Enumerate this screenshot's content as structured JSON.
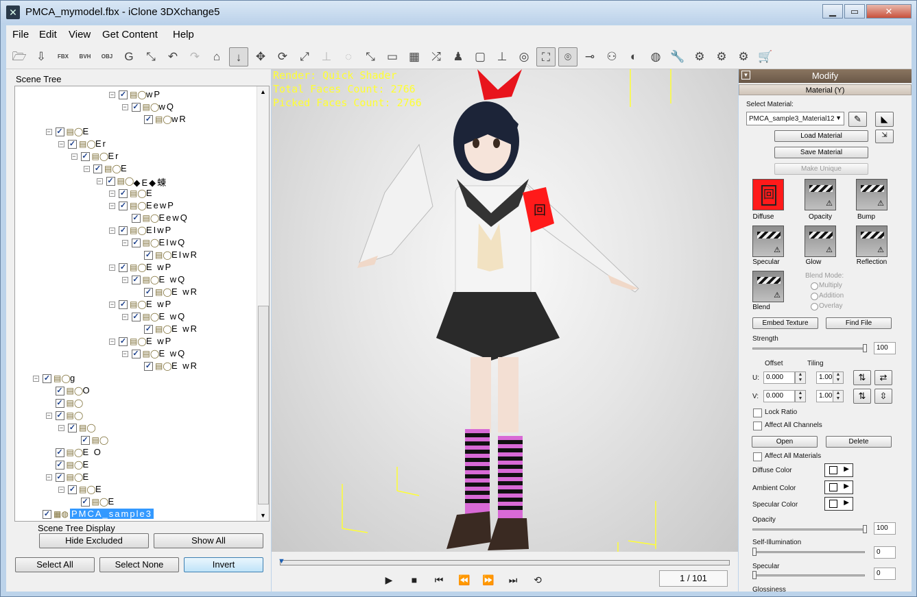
{
  "window": {
    "title": "PMCA_mymodel.fbx - iClone 3DXchange5",
    "minimize": "▁",
    "maximize": "▭",
    "close": "✕"
  },
  "menu": [
    "File",
    "Edit",
    "View",
    "Get Content",
    "Help"
  ],
  "toolbar": {
    "icons": [
      "open-folder-icon",
      "import-icon",
      "export-fbx-icon",
      "export-bvh-icon",
      "export-obj-icon",
      "g-icon",
      "convert-icon",
      "undo-icon",
      "redo-icon",
      "home-icon",
      "select-icon",
      "move-icon",
      "rotate-icon",
      "scale-icon",
      "align-icon",
      "reset-icon",
      "frame-icon",
      "box-icon",
      "grid-icon",
      "axis-icon",
      "character-icon",
      "camera-view-icon",
      "floor-icon",
      "sphere-icon",
      "fit-icon",
      "render-icon",
      "capsule-icon",
      "bone-icon",
      "bone-color-icon",
      "globe-icon",
      "wrench-icon",
      "settings-icon",
      "network-icon",
      "cube-convert-icon",
      "cart-icon"
    ],
    "glyphs": [
      "🗁",
      "⇩",
      "FBX",
      "BVH",
      "OBJ",
      "G",
      "⤡",
      "↶",
      "↷",
      "⌂",
      "↓",
      "✥",
      "⟳",
      "⤢",
      "⊥",
      "◌",
      "⤡",
      "▭",
      "▦",
      "⤮",
      "♟",
      "▢",
      "⊥",
      "◎",
      "⛶",
      "⌾",
      "⊸",
      "⚇",
      "◐",
      "◍",
      "🔧",
      "⚙",
      "⚙",
      "⚙",
      "🛒"
    ],
    "active": [
      10,
      24,
      25
    ],
    "dim": [
      8,
      14,
      15
    ]
  },
  "scene_tree": {
    "label": "Scene Tree",
    "nodes": [
      {
        "label": "wP"
      },
      {
        "label": "wQ"
      },
      {
        "label": "wR"
      },
      {
        "label": "E"
      },
      {
        "label": "Er"
      },
      {
        "label": "Er"
      },
      {
        "label": "E"
      },
      {
        "label": "◆E◆蝀"
      },
      {
        "label": "E"
      },
      {
        "label": "EewP"
      },
      {
        "label": "EewQ"
      },
      {
        "label": "EIwP"
      },
      {
        "label": "EIwQ"
      },
      {
        "label": "EIwR"
      },
      {
        "label": "E wP"
      },
      {
        "label": "E wQ"
      },
      {
        "label": "E wR"
      },
      {
        "label": "E wP"
      },
      {
        "label": "E wQ"
      },
      {
        "label": "E wR"
      },
      {
        "label": "E wP"
      },
      {
        "label": "E wQ"
      },
      {
        "label": "E wR"
      },
      {
        "label": "g"
      },
      {
        "label": "O"
      },
      {
        "label": ""
      },
      {
        "label": ""
      },
      {
        "label": ""
      },
      {
        "label": ""
      },
      {
        "label": "E O"
      },
      {
        "label": "E"
      },
      {
        "label": "E"
      },
      {
        "label": "E"
      },
      {
        "label": "E"
      },
      {
        "label": "PMCA_sample3"
      }
    ]
  },
  "scene_display": {
    "label": "Scene Tree Display",
    "hide_excluded": "Hide Excluded",
    "show_all": "Show All"
  },
  "select": {
    "all": "Select All",
    "none": "Select None",
    "invert": "Invert"
  },
  "viewport": {
    "render": "Render: Quick Shader",
    "total_faces": "Total Faces Count: 2766",
    "picked_faces": "Picked Faces Count: 2766"
  },
  "timeline": {
    "frame": "1 / 101",
    "progress": 0.0
  },
  "modify": {
    "header": "Modify",
    "section": "Material (Y)",
    "select_material_label": "Select Material:",
    "select_material_value": "PMCA_sample3_Material12",
    "load": "Load Material",
    "save": "Save Material",
    "unique": "Make Unique",
    "channels": [
      "Diffuse",
      "Opacity",
      "Bump",
      "Specular",
      "Glow",
      "Reflection",
      "Blend"
    ],
    "blend_mode_label": "Blend Mode:",
    "blend_modes": [
      "Multiply",
      "Addition",
      "Overlay"
    ],
    "embed": "Embed Texture",
    "find": "Find File",
    "strength_label": "Strength",
    "strength": "100",
    "offset_label": "Offset",
    "tiling_label": "Tiling",
    "u_label": "U:",
    "v_label": "V:",
    "u_offset": "0.000",
    "u_tiling": "1.000",
    "v_offset": "0.000",
    "v_tiling": "1.000",
    "lock_ratio": "Lock Ratio",
    "affect_channels": "Affect All Channels",
    "open": "Open",
    "delete": "Delete",
    "affect_materials": "Affect All Materials",
    "diffuse_color": "Diffuse Color",
    "ambient_color": "Ambient Color",
    "specular_color": "Specular Color",
    "opacity_label": "Opacity",
    "opacity": "100",
    "self_illum_label": "Self-Illumination",
    "self_illum": "0",
    "specular_label": "Specular",
    "specular": "0",
    "glossiness_label": "Glossiness"
  },
  "colors": {
    "accent_red": "#ff1a1a",
    "viewport_text": "#ffff33",
    "selection": "#3399ff"
  }
}
